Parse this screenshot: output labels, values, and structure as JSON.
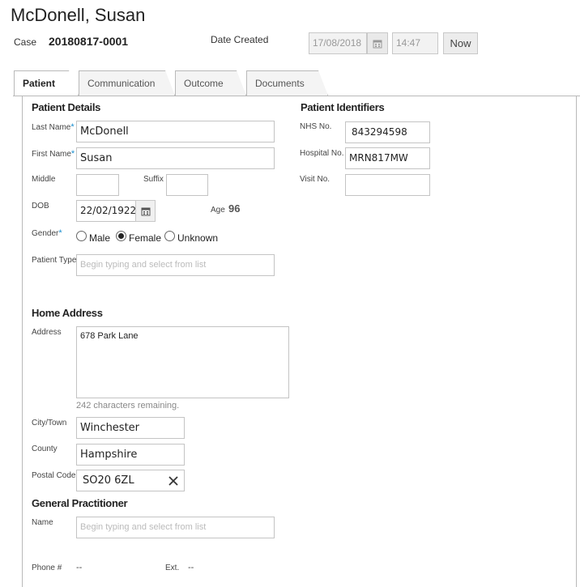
{
  "header": {
    "patient_name": "McDonell, Susan",
    "case_label": "Case",
    "case_number": "20180817-0001",
    "date_created_label": "Date Created",
    "date_value": "17/08/2018",
    "time_value": "14:47",
    "now_button": "Now"
  },
  "tabs": [
    {
      "label": "Patient",
      "active": true
    },
    {
      "label": "Communication",
      "active": false
    },
    {
      "label": "Outcome",
      "active": false
    },
    {
      "label": "Documents",
      "active": false
    }
  ],
  "patient_details": {
    "heading": "Patient Details",
    "last_name_label": "Last Name",
    "last_name": "McDonell",
    "first_name_label": "First Name",
    "first_name": "Susan",
    "middle_label": "Middle",
    "middle": "",
    "suffix_label": "Suffix",
    "suffix": "",
    "dob_label": "DOB",
    "dob": "22/02/1922",
    "age_label": "Age",
    "age": "96",
    "gender_label": "Gender",
    "gender_options": [
      "Male",
      "Female",
      "Unknown"
    ],
    "gender_selected": "Female",
    "patient_type_label": "Patient Type",
    "patient_type_placeholder": "Begin typing and select from list"
  },
  "patient_identifiers": {
    "heading": "Patient Identifiers",
    "nhs_label": "NHS No.",
    "nhs": "843294598",
    "hospital_label": "Hospital No.",
    "hospital": "MRN817MW",
    "visit_label": "Visit No.",
    "visit": ""
  },
  "home_address": {
    "heading": "Home Address",
    "address_label": "Address",
    "address": "678 Park Lane",
    "chars_remaining": "242 characters remaining.",
    "city_label": "City/Town",
    "city": "Winchester",
    "county_label": "County",
    "county": "Hampshire",
    "postal_label": "Postal Code",
    "postal": "SO20 6ZL"
  },
  "gp": {
    "heading": "General Practitioner",
    "name_label": "Name",
    "name_placeholder": "Begin typing and select from list",
    "phone_label": "Phone #",
    "phone": "--",
    "ext_label": "Ext.",
    "ext": "--"
  },
  "icons": {
    "calendar": "calendar-icon",
    "clear": "close-icon",
    "required": "required-asterisk"
  },
  "colors": {
    "required": "#1a8fd0",
    "border": "#c4c4c4"
  }
}
